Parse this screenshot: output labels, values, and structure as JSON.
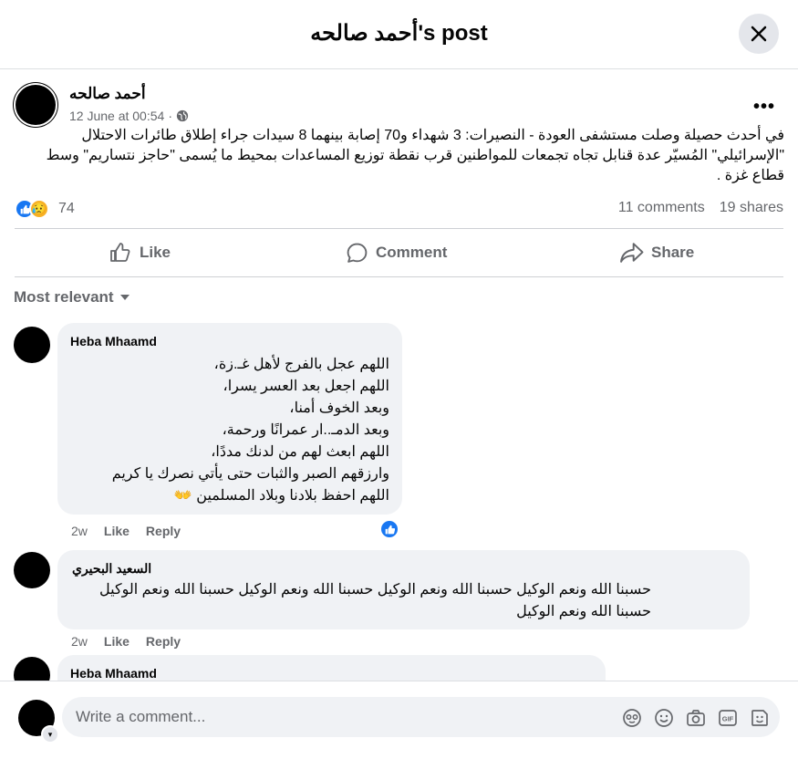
{
  "header": {
    "title": "أحمد صالحه's post"
  },
  "post": {
    "author": "أحمد صالحه",
    "timestamp": "12 June at 00:54",
    "text": "في أحدث حصيلة وصلت مستشفى العودة - النصيرات: 3 شهداء و70 إصابة بينهما 8 سيدات جراء إطلاق طائرات الاحتلال \"الإسرائيلي\" المُسيّر عدة قنابل تجاه تجمعات للمواطنين قرب نقطة توزيع المساعدات بمحيط ما يُسمى \"حاجز نتساريم\" وسط قطاع غزة .",
    "reaction_count": "74",
    "comments_count": "11 comments",
    "shares_count": "19 shares"
  },
  "actions": {
    "like": "Like",
    "comment": "Comment",
    "share": "Share"
  },
  "sort": {
    "label": "Most relevant"
  },
  "comments": [
    {
      "author": "Heba Mhaamd",
      "lines": [
        "اللهم عجل بالفرج لأهل غـ.زة،",
        "اللهم اجعل بعد العسر يسرا،",
        "وبعد الخوف أمنا،",
        "وبعد الدمـ..ار عمرانًا ورحمة،",
        "اللهم ابعث لهم من لدنك مددًا،",
        "وارزقهم الصبر والثبات حتى يأتي نصرك يا كريم",
        "اللهم احفظ بلادنا وبلاد المسلمين 👐"
      ],
      "time": "2w",
      "like": "Like",
      "reply": "Reply"
    },
    {
      "author": "السعيد البحيري",
      "lines": [
        "حسبنا الله ونعم الوكيل حسبنا الله ونعم الوكيل حسبنا الله ونعم الوكيل حسبنا الله ونعم الوكيل",
        "حسبنا الله ونعم الوكيل"
      ],
      "time": "2w",
      "like": "Like",
      "reply": "Reply"
    },
    {
      "author": "Heba Mhaamd"
    }
  ],
  "composer": {
    "placeholder": "Write a comment..."
  },
  "colors": {
    "accent": "#1877f2",
    "muted": "#65676b",
    "bubble": "#f0f2f5"
  }
}
